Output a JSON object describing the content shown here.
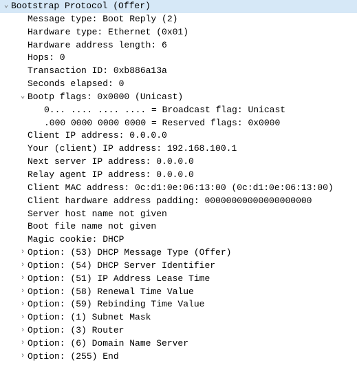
{
  "root": {
    "label": "Bootstrap Protocol (Offer)"
  },
  "fields": {
    "message_type": "Message type: Boot Reply (2)",
    "hardware_type": "Hardware type: Ethernet (0x01)",
    "hw_addr_len": "Hardware address length: 6",
    "hops": "Hops: 0",
    "transaction_id": "Transaction ID: 0xb886a13a",
    "seconds_elapsed": "Seconds elapsed: 0"
  },
  "flags": {
    "header": "Bootp flags: 0x0000 (Unicast)",
    "broadcast": "0... .... .... .... = Broadcast flag: Unicast",
    "reserved": ".000 0000 0000 0000 = Reserved flags: 0x0000"
  },
  "addrs": {
    "client_ip": "Client IP address: 0.0.0.0",
    "your_ip": "Your (client) IP address: 192.168.100.1",
    "next_server_ip": "Next server IP address: 0.0.0.0",
    "relay_agent_ip": "Relay agent IP address: 0.0.0.0",
    "client_mac": "Client MAC address: 0c:d1:0e:06:13:00 (0c:d1:0e:06:13:00)",
    "client_hw_padding": "Client hardware address padding: 00000000000000000000",
    "server_host": "Server host name not given",
    "boot_file": "Boot file name not given",
    "magic_cookie": "Magic cookie: DHCP"
  },
  "options": {
    "o53": "Option: (53) DHCP Message Type (Offer)",
    "o54": "Option: (54) DHCP Server Identifier",
    "o51": "Option: (51) IP Address Lease Time",
    "o58": "Option: (58) Renewal Time Value",
    "o59": "Option: (59) Rebinding Time Value",
    "o1": "Option: (1) Subnet Mask",
    "o3": "Option: (3) Router",
    "o6": "Option: (6) Domain Name Server",
    "o255": "Option: (255) End"
  },
  "glyphs": {
    "open": "⌄",
    "closed": "›",
    "none": ""
  }
}
